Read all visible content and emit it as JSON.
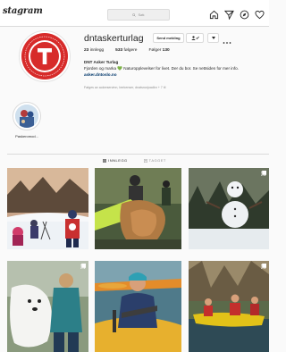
{
  "topbar": {
    "logo": "stagram",
    "search_placeholder": "Søk"
  },
  "profile": {
    "username": "dntaskerturlag",
    "send_message_label": "Send melding",
    "stats": {
      "posts_count": "23",
      "posts_label": "innlegg",
      "followers_count": "533",
      "followers_label": "følgere",
      "following_label": "Følger",
      "following_count": "130"
    },
    "bio": {
      "name": "DNT Asker Turlag",
      "line1": "Fjorden og marka 💚 Naturopplevelser for livet. Der du bor. Se nettsiden for mer info.",
      "link": "asker.dntoslo.no"
    },
    "followed_by": "Følges av aokerservinn, berkenser, dnatsnorjoadkn + 7 til"
  },
  "highlight": {
    "label": "Paskeromod..."
  },
  "tabs": {
    "posts": "INNLEGG",
    "tagged": "TAGGET"
  }
}
